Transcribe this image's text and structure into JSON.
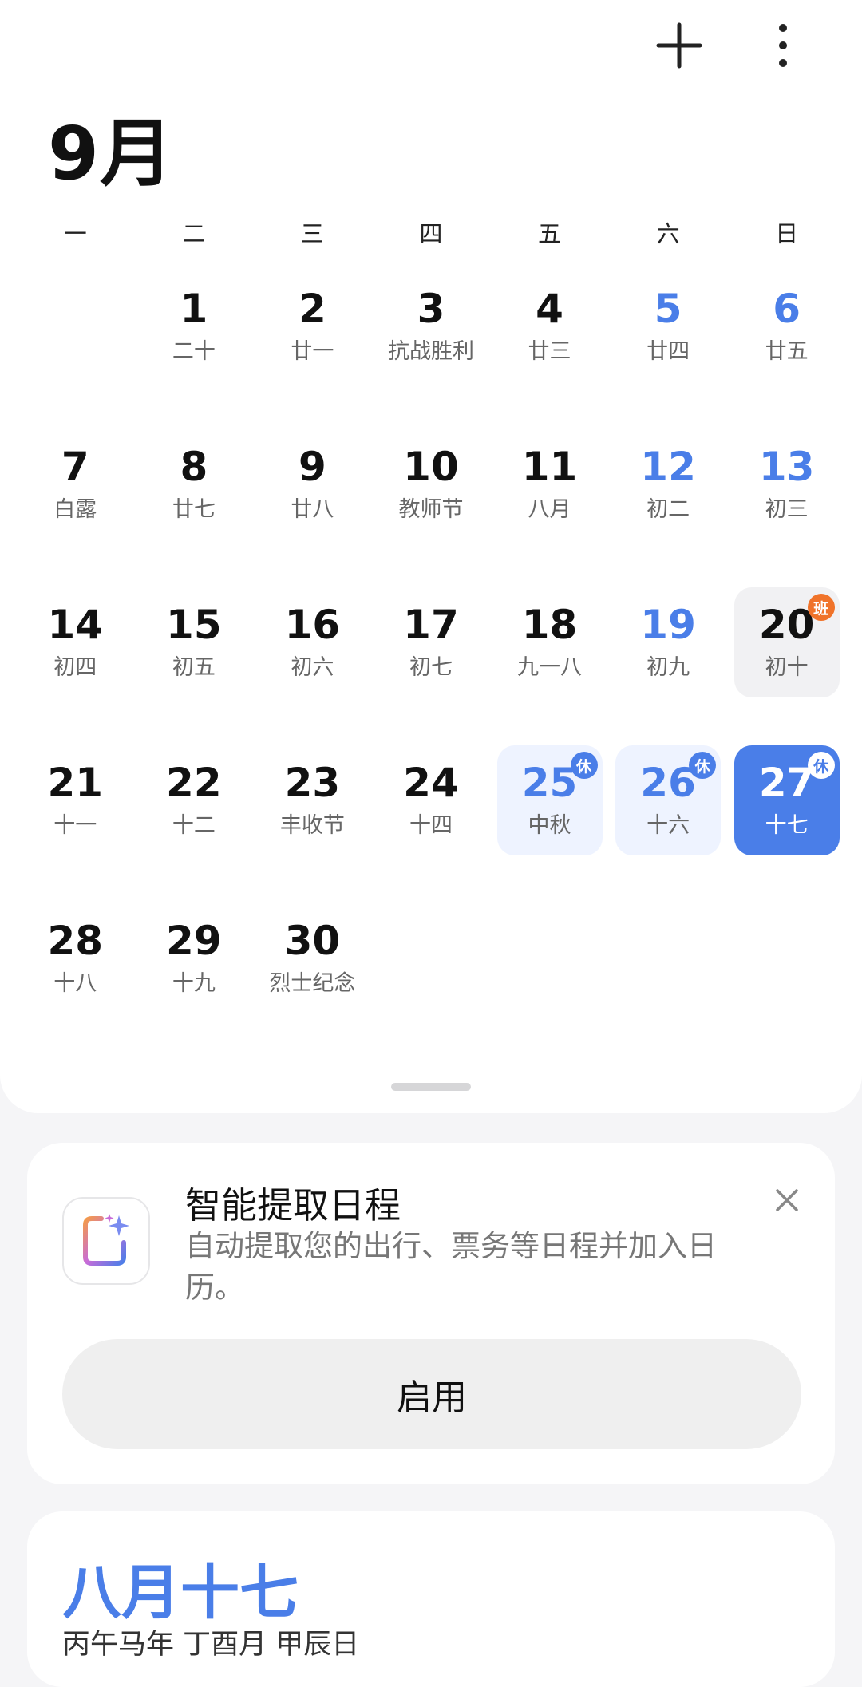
{
  "toolbar": {
    "add_icon": "plus-icon",
    "more_icon": "more-vertical-icon"
  },
  "month_title": "9月",
  "weekdays": [
    "一",
    "二",
    "三",
    "四",
    "五",
    "六",
    "日"
  ],
  "weeks": [
    [
      {
        "day": "",
        "sub": "",
        "type": "empty"
      },
      {
        "day": "1",
        "sub": "二十",
        "type": "normal"
      },
      {
        "day": "2",
        "sub": "廿一",
        "type": "normal"
      },
      {
        "day": "3",
        "sub": "抗战胜利",
        "type": "normal"
      },
      {
        "day": "4",
        "sub": "廿三",
        "type": "normal"
      },
      {
        "day": "5",
        "sub": "廿四",
        "type": "weekend"
      },
      {
        "day": "6",
        "sub": "廿五",
        "type": "weekend"
      }
    ],
    [
      {
        "day": "7",
        "sub": "白露",
        "type": "normal"
      },
      {
        "day": "8",
        "sub": "廿七",
        "type": "normal"
      },
      {
        "day": "9",
        "sub": "廿八",
        "type": "normal"
      },
      {
        "day": "10",
        "sub": "教师节",
        "type": "normal"
      },
      {
        "day": "11",
        "sub": "八月",
        "type": "normal"
      },
      {
        "day": "12",
        "sub": "初二",
        "type": "weekend"
      },
      {
        "day": "13",
        "sub": "初三",
        "type": "weekend"
      }
    ],
    [
      {
        "day": "14",
        "sub": "初四",
        "type": "normal"
      },
      {
        "day": "15",
        "sub": "初五",
        "type": "normal"
      },
      {
        "day": "16",
        "sub": "初六",
        "type": "normal"
      },
      {
        "day": "17",
        "sub": "初七",
        "type": "normal"
      },
      {
        "day": "18",
        "sub": "九一八",
        "type": "normal"
      },
      {
        "day": "19",
        "sub": "初九",
        "type": "weekend"
      },
      {
        "day": "20",
        "sub": "初十",
        "type": "work",
        "badge": "班"
      }
    ],
    [
      {
        "day": "21",
        "sub": "十一",
        "type": "normal"
      },
      {
        "day": "22",
        "sub": "十二",
        "type": "normal"
      },
      {
        "day": "23",
        "sub": "丰收节",
        "type": "normal"
      },
      {
        "day": "24",
        "sub": "十四",
        "type": "normal"
      },
      {
        "day": "25",
        "sub": "中秋",
        "type": "holiday",
        "badge": "休"
      },
      {
        "day": "26",
        "sub": "十六",
        "type": "holiday",
        "badge": "休"
      },
      {
        "day": "27",
        "sub": "十七",
        "type": "today",
        "badge": "休"
      }
    ],
    [
      {
        "day": "28",
        "sub": "十八",
        "type": "normal"
      },
      {
        "day": "29",
        "sub": "十九",
        "type": "normal"
      },
      {
        "day": "30",
        "sub": "烈士纪念",
        "type": "normal"
      },
      {
        "day": "",
        "sub": "",
        "type": "empty"
      },
      {
        "day": "",
        "sub": "",
        "type": "empty"
      },
      {
        "day": "",
        "sub": "",
        "type": "empty"
      },
      {
        "day": "",
        "sub": "",
        "type": "empty"
      }
    ]
  ],
  "promo": {
    "icon": "smart-schedule-icon",
    "title": "智能提取日程",
    "description": "自动提取您的出行、票务等日程并加入日历。",
    "close_icon": "close-icon",
    "enable_label": "启用"
  },
  "lunar": {
    "date": "八月十七",
    "ganzhi": "丙午马年 丁酉月 甲辰日"
  },
  "colors": {
    "accent": "#4a7ee8",
    "work_badge": "#f0732a",
    "holiday_bg": "#eef3ff",
    "today_bg": "#4a7ee8"
  }
}
